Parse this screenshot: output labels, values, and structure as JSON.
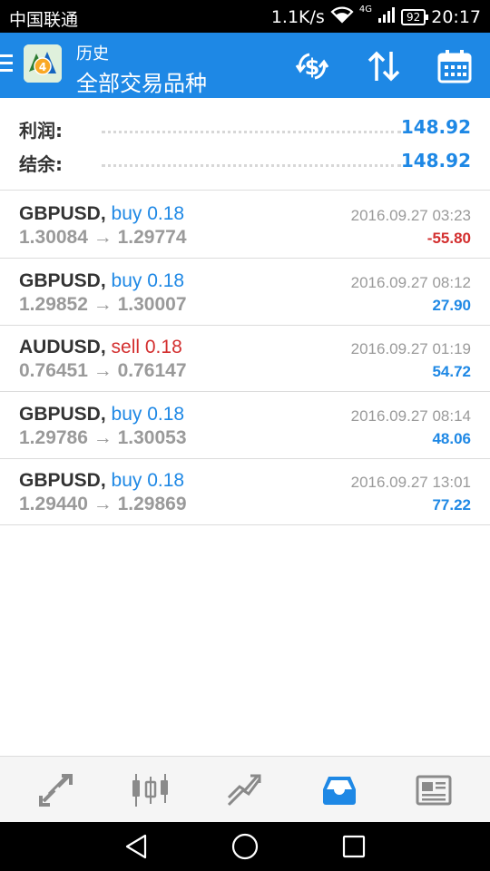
{
  "status_bar": {
    "carrier": "中国联通",
    "speed": "1.1K/s",
    "network": "4G",
    "battery": "92",
    "time": "20:17"
  },
  "app_bar": {
    "subtitle": "历史",
    "title": "全部交易品种",
    "icons": [
      "menu-icon",
      "metatrader-logo",
      "currency-exchange-icon",
      "sort-icon",
      "calendar-icon"
    ],
    "color": "#1e88e5"
  },
  "summary": {
    "profit_label": "利润:",
    "profit_value": "148.92",
    "balance_label": "结余:",
    "balance_value": "148.92"
  },
  "deals": [
    {
      "symbol": "GBPUSD",
      "side": "buy",
      "volume": "0.18",
      "open_price": "1.30084",
      "close_price": "1.29774",
      "time": "2016.09.27 03:23",
      "profit": "-55.80"
    },
    {
      "symbol": "GBPUSD",
      "side": "buy",
      "volume": "0.18",
      "open_price": "1.29852",
      "close_price": "1.30007",
      "time": "2016.09.27 08:12",
      "profit": "27.90"
    },
    {
      "symbol": "AUDUSD",
      "side": "sell",
      "volume": "0.18",
      "open_price": "0.76451",
      "close_price": "0.76147",
      "time": "2016.09.27 01:19",
      "profit": "54.72"
    },
    {
      "symbol": "GBPUSD",
      "side": "buy",
      "volume": "0.18",
      "open_price": "1.29786",
      "close_price": "1.30053",
      "time": "2016.09.27 08:14",
      "profit": "48.06"
    },
    {
      "symbol": "GBPUSD",
      "side": "buy",
      "volume": "0.18",
      "open_price": "1.29440",
      "close_price": "1.29869",
      "time": "2016.09.27 13:01",
      "profit": "77.22"
    }
  ],
  "arrow": "→",
  "bottom_nav": {
    "items": [
      "quotes-icon",
      "chart-icon",
      "trade-icon",
      "history-icon",
      "news-icon"
    ],
    "active": "history-icon",
    "active_color": "#1e88e5",
    "inactive_color": "#8a8a8a"
  },
  "system_nav": [
    "back-icon",
    "home-icon",
    "recents-icon"
  ]
}
